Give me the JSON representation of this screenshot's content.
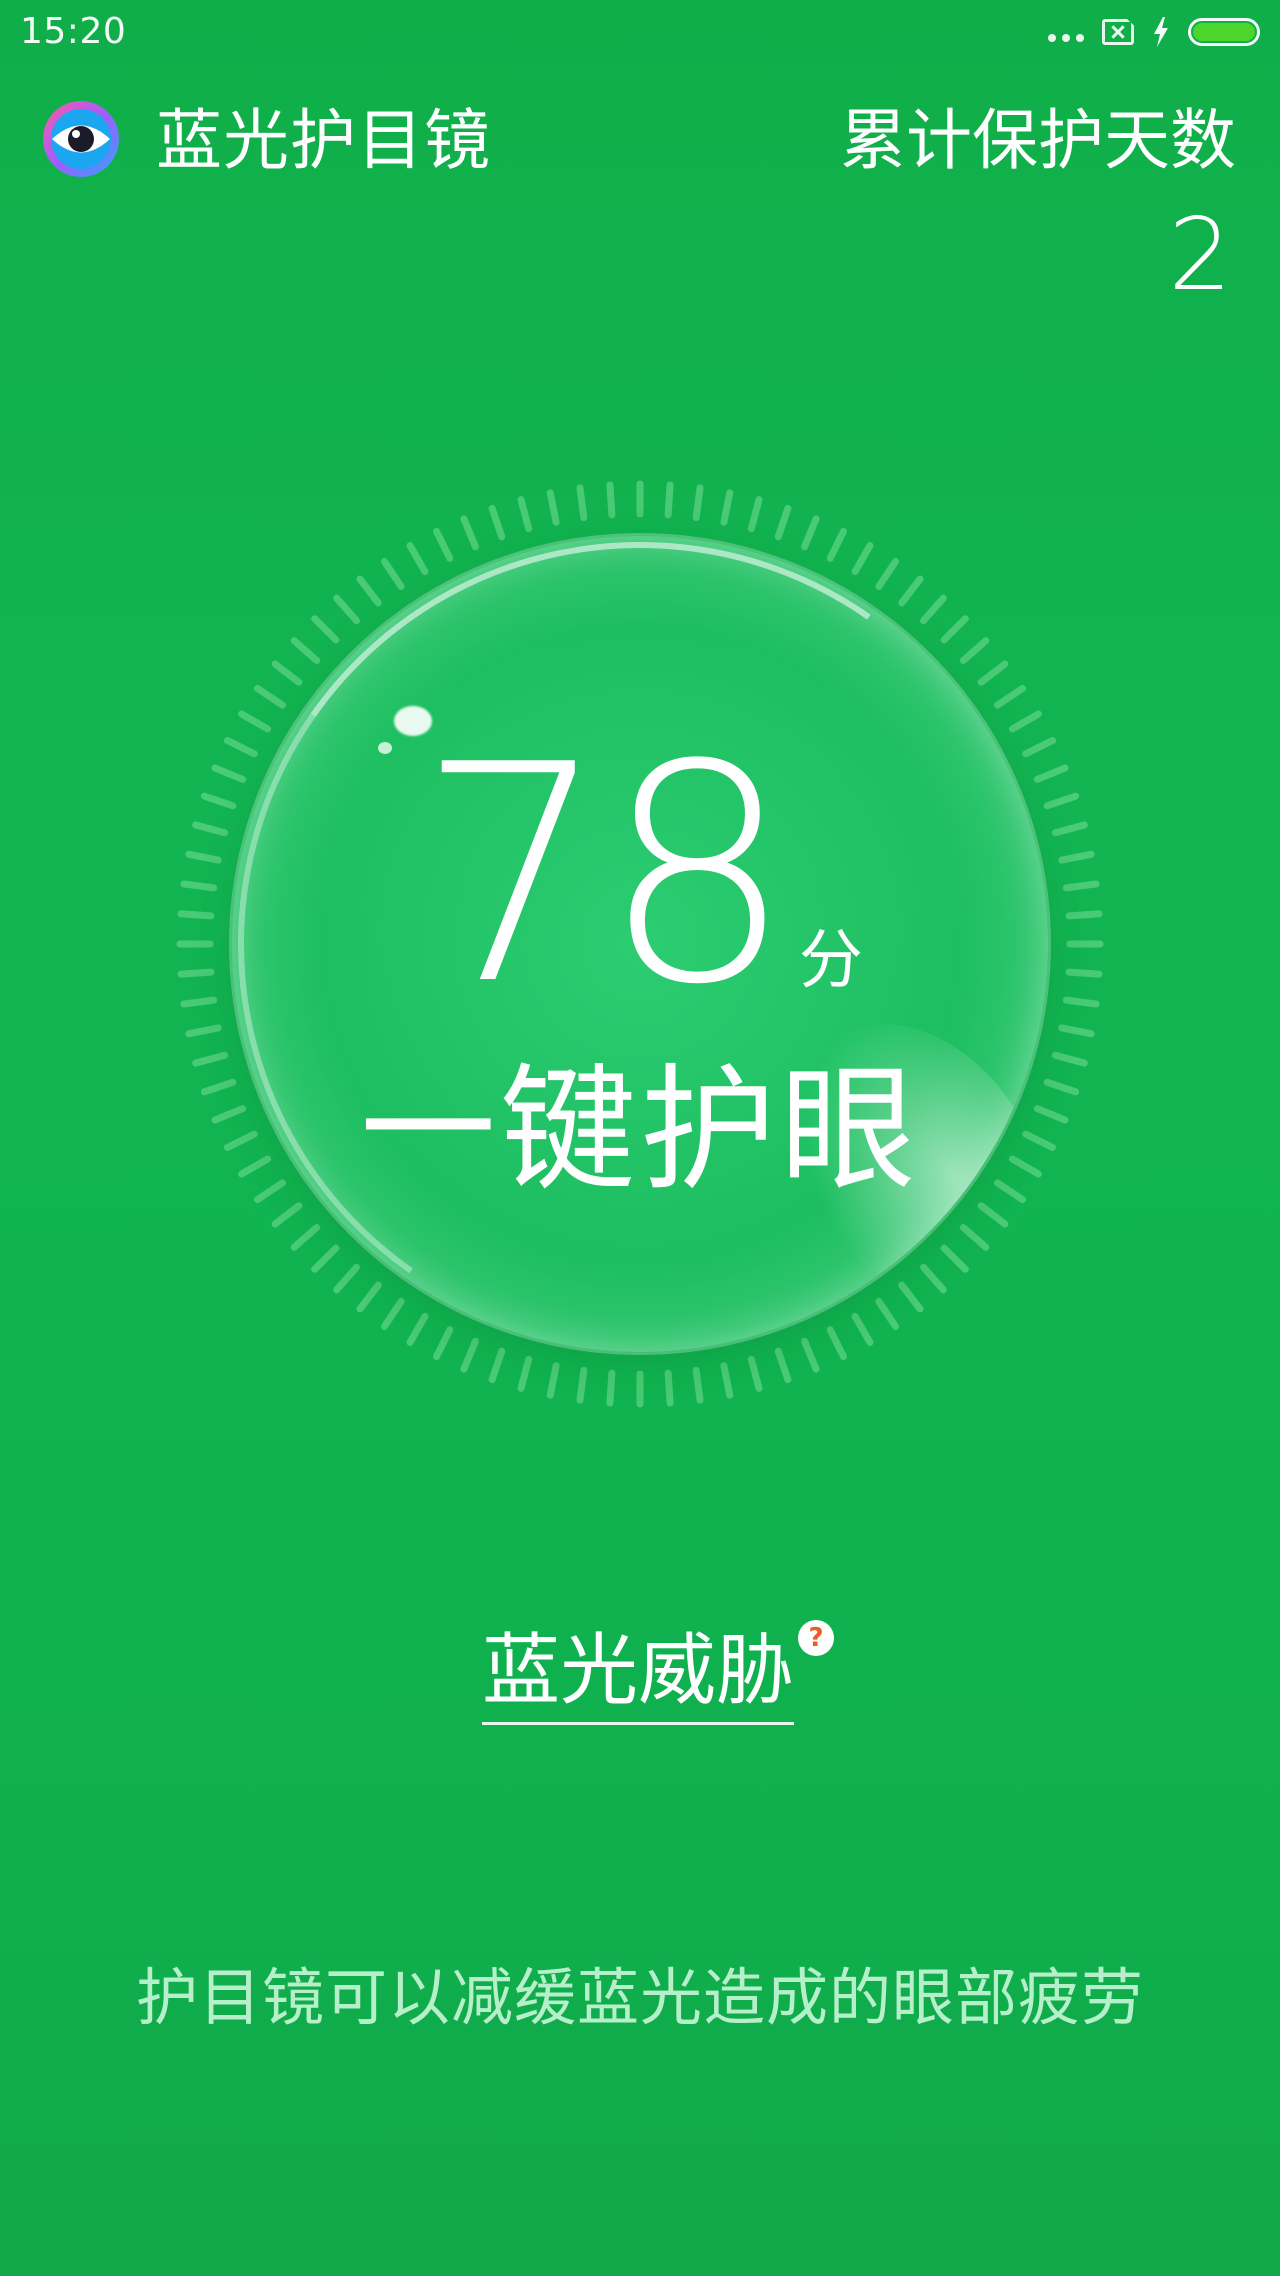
{
  "status_bar": {
    "time": "15:20",
    "battery_color": "#4cd52a"
  },
  "header": {
    "app_title": "蓝光护目镜",
    "days_label": "累计保护天数",
    "days_value": "2",
    "logo_icon": "eye-icon"
  },
  "bubble": {
    "score": "78",
    "score_unit": "分",
    "action_label": "一键护眼"
  },
  "threat": {
    "label": "蓝光威胁",
    "help_glyph": "?",
    "help_color": "#f05a28"
  },
  "tip": {
    "text": "护目镜可以减缓蓝光造成的眼部疲劳"
  },
  "colors": {
    "background": "#10a84a",
    "text": "#ffffff"
  }
}
